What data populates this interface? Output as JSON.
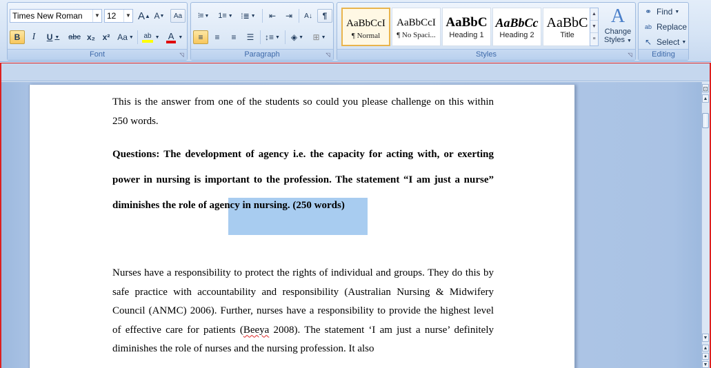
{
  "ribbon": {
    "font_group": {
      "label": "Font",
      "font_name": "Times New Roman",
      "font_size": "12",
      "grow_label": "A",
      "shrink_label": "A",
      "clear_label": "Aa",
      "bold_label": "B",
      "italic_label": "I",
      "underline_label": "U",
      "strike_label": "abc",
      "subscript_label": "x₂",
      "superscript_label": "x²",
      "case_label": "Aa",
      "highlight_label": "ab",
      "font_color_label": "A",
      "colors": {
        "highlight": "#ffff00",
        "font_color": "#e00000"
      }
    },
    "paragraph_group": {
      "label": "Paragraph"
    },
    "styles_group": {
      "label": "Styles",
      "tiles": [
        {
          "sample": "AaBbCcI",
          "name": "¶ Normal"
        },
        {
          "sample": "AaBbCcI",
          "name": "¶ No Spaci..."
        },
        {
          "sample": "AaBbC",
          "name": "Heading 1"
        },
        {
          "sample": "AaBbCc",
          "name": "Heading 2"
        },
        {
          "sample": "AaBbC",
          "name": "Title"
        }
      ],
      "change_styles_line1": "Change",
      "change_styles_line2": "Styles",
      "change_styles_icon": "A"
    },
    "editing_group": {
      "label": "Editing",
      "find_label": "Find",
      "replace_label": "Replace",
      "select_label": "Select"
    }
  },
  "document": {
    "intro": "This is the answer from one of the students so could you please challenge on this within 250 words.",
    "question_part1": "Questions: The development of agency i.e. the capacity for acting with, or exerting power in nursing is important to the profession. The statement “I am just a nurse” diminishes ",
    "question_selected": "the role of agency in nursing.",
    "question_part2": " (250 words)",
    "body_part1": "Nurses have a responsibility to protect the rights of individual and groups. They do this by safe practice with accountability and responsibility (Australian Nursing & Midwifery Council (ANMC) 2006). Further, nurses have a responsibility to provide the highest level of effective care for patients (",
    "body_misspelled": "Beeya",
    "body_part2": " 2008).  The statement ‘I am just a nurse’ definitely diminishes the role of nurses and the nursing profession. It also"
  }
}
